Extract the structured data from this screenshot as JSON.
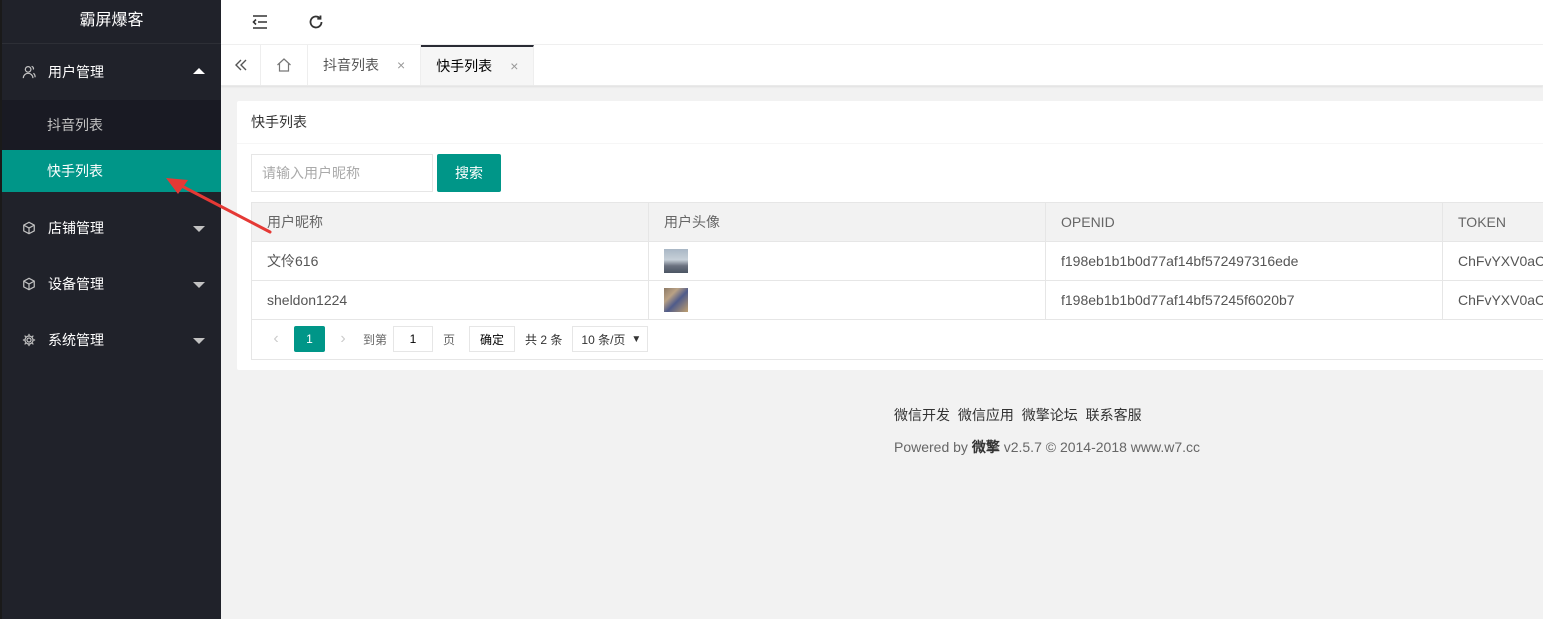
{
  "app": {
    "title": "霸屏爆客"
  },
  "sidebar": {
    "groups": [
      {
        "label": "用户管理",
        "icon": "user-icon",
        "expanded": true,
        "items": [
          {
            "label": "抖音列表",
            "active": false
          },
          {
            "label": "快手列表",
            "active": true
          }
        ]
      },
      {
        "label": "店铺管理",
        "icon": "cube-icon",
        "expanded": false
      },
      {
        "label": "设备管理",
        "icon": "cube-icon",
        "expanded": false
      },
      {
        "label": "系统管理",
        "icon": "gear-icon",
        "expanded": false
      }
    ]
  },
  "header": {
    "menu_toggle_icon": "menu-fold-icon",
    "refresh_icon": "refresh-icon"
  },
  "tabs": {
    "items": [
      {
        "label": "抖音列表",
        "close": "×",
        "active": false
      },
      {
        "label": "快手列表",
        "close": "×",
        "active": true
      }
    ]
  },
  "card": {
    "title": "快手列表",
    "search": {
      "placeholder": "请输入用户昵称",
      "button_label": "搜索"
    },
    "table": {
      "columns": [
        "用户昵称",
        "用户头像",
        "OPENID",
        "TOKEN"
      ],
      "rows": [
        {
          "nickname": "文伶616",
          "openid": "f198eb1b1b0d77af14bf572497316ede",
          "token": "ChFvYXV0aC"
        },
        {
          "nickname": "sheldon1224",
          "openid": "f198eb1b1b0d77af14bf57245f6020b7",
          "token": "ChFvYXV0aC"
        }
      ]
    },
    "pager": {
      "prev": "‹",
      "current": "1",
      "next": "›",
      "goto_label": "到第",
      "goto_value": "1",
      "page_unit": "页",
      "confirm_label": "确定",
      "total_label": "共 2 条",
      "page_size": "10 条/页"
    }
  },
  "footer": {
    "links": [
      "微信开发",
      "微信应用",
      "微擎论坛",
      "联系客服"
    ],
    "powered_prefix": "Powered by",
    "powered_brand": "微擎",
    "powered_suffix": "v2.5.7 © 2014-2018 www.w7.cc"
  },
  "colors": {
    "accent": "#009688",
    "sidebar_bg": "#20222a",
    "annotation": "#e53935"
  }
}
